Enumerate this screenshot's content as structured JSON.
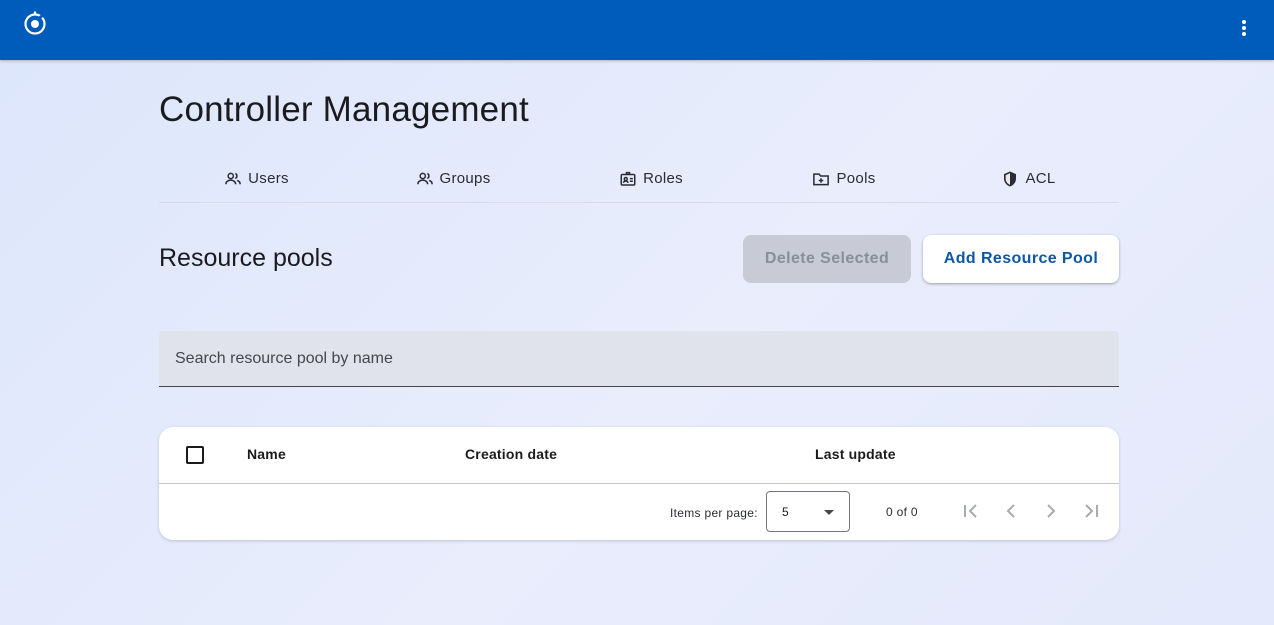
{
  "header": {
    "logo_icon": "app-logo-icon",
    "menu_icon": "more-vert-icon",
    "background_color": "#005cbb"
  },
  "page": {
    "title": "Controller Management"
  },
  "tabs": [
    {
      "label": "Users",
      "icon": "users-icon"
    },
    {
      "label": "Groups",
      "icon": "groups-icon"
    },
    {
      "label": "Roles",
      "icon": "roles-icon"
    },
    {
      "label": "Pools",
      "icon": "pools-icon"
    },
    {
      "label": "ACL",
      "icon": "shield-icon"
    }
  ],
  "section": {
    "title": "Resource pools",
    "delete_label": "Delete Selected",
    "add_label": "Add Resource Pool"
  },
  "search": {
    "placeholder": "Search resource pool by name",
    "value": ""
  },
  "table": {
    "columns": [
      "Name",
      "Creation date",
      "Last update"
    ],
    "rows": []
  },
  "paginator": {
    "items_per_page_label": "Items per page:",
    "items_per_page_value": "5",
    "range_label": "0 of 0"
  },
  "colors": {
    "accent": "#005cbb",
    "primary_text_button": "#0d57a3"
  }
}
